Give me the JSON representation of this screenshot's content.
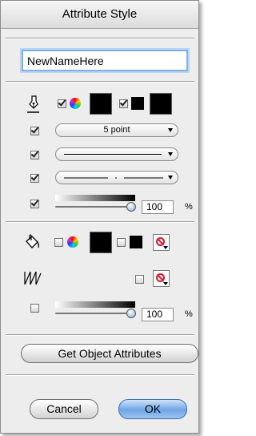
{
  "title": "Attribute Style",
  "name_field": {
    "value": "NewNameHere"
  },
  "stroke": {
    "pen_icon": "pen-nib-icon",
    "color_enabled": true,
    "color": "#000000",
    "pattern_enabled": true,
    "pattern_color": "#000000",
    "width_enabled": true,
    "width_label": "5 point",
    "line_style_enabled": true,
    "dash_style_enabled": true,
    "opacity_enabled": true,
    "opacity_value": "100",
    "opacity_percent": 1.0,
    "percent_label": "%"
  },
  "fill": {
    "bucket_icon": "paint-bucket-icon",
    "color_enabled": false,
    "color": "#000000",
    "pattern_enabled": false,
    "pattern_icon": "no-color-icon"
  },
  "hatch": {
    "hatch_icon": "hatch-icon",
    "enabled": false,
    "value_icon": "no-color-icon"
  },
  "opacity2": {
    "enabled": false,
    "opacity_value": "100",
    "opacity_percent": 1.0,
    "percent_label": "%"
  },
  "buttons": {
    "get_attributes": "Get Object Attributes",
    "cancel": "Cancel",
    "ok": "OK"
  },
  "colors": {
    "accent_blue": "#6ea5e6",
    "no_color_red": "#d9142c"
  }
}
